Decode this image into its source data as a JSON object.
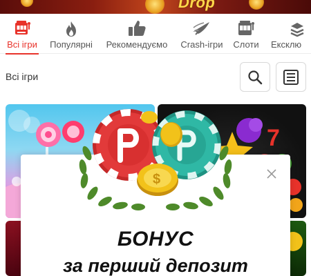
{
  "banner": {
    "promo_word": "Drop"
  },
  "categories": [
    {
      "label": "Всі ігри",
      "icon": "slot-machine-icon",
      "active": true
    },
    {
      "label": "Популярні",
      "icon": "flame-icon",
      "active": false
    },
    {
      "label": "Рекомендуємо",
      "icon": "thumbs-up-icon",
      "active": false
    },
    {
      "label": "Crash-ігри",
      "icon": "rocket-icon",
      "active": false
    },
    {
      "label": "Слоти",
      "icon": "slot-reels-icon",
      "active": false
    },
    {
      "label": "Ексклю",
      "icon": "exclusive-stack-icon",
      "active": false
    }
  ],
  "section": {
    "title": "Всі ігри"
  },
  "toolbar": {
    "search_icon": "search-icon",
    "list_icon": "list-view-icon"
  },
  "modal": {
    "title": "БОНУС",
    "subtitle": "за перший депозит",
    "close_icon": "close-icon"
  },
  "colors": {
    "accent": "#e8322a",
    "chip_red": "#e23a3a",
    "chip_teal": "#2fb8a5",
    "gold": "#f2c21a",
    "laurel": "#4e8a2a"
  }
}
